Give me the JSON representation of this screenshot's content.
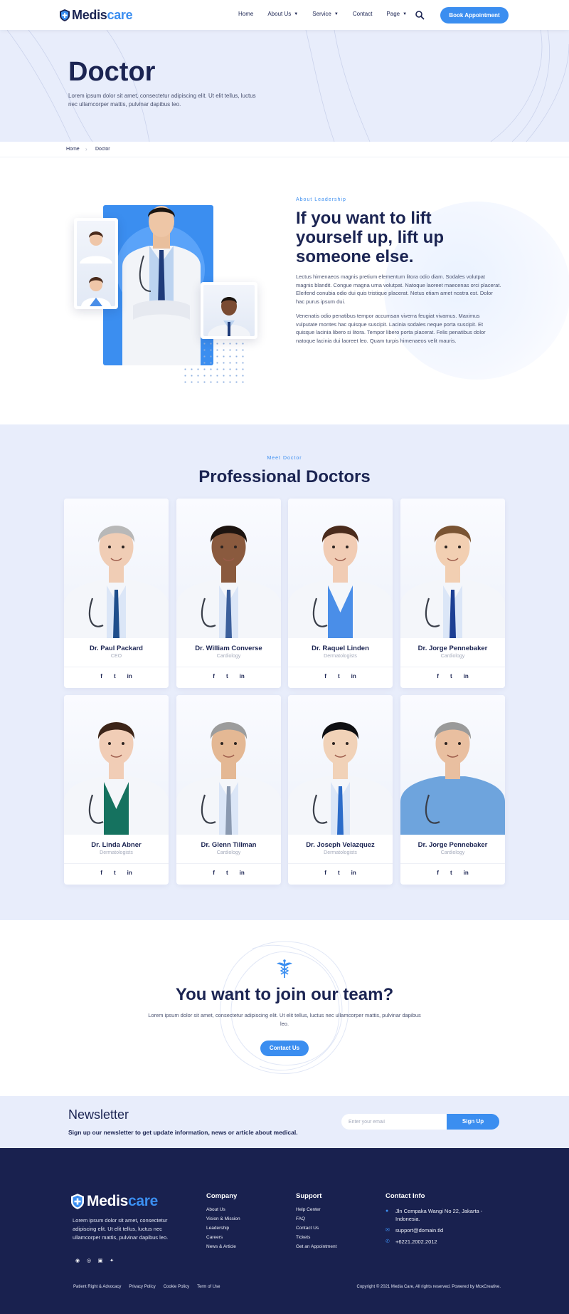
{
  "header": {
    "logo_part1": "Medis",
    "logo_part2": "care",
    "nav": [
      {
        "label": "Home",
        "chevron": false
      },
      {
        "label": "About Us",
        "chevron": true
      },
      {
        "label": "Service",
        "chevron": true
      },
      {
        "label": "Contact",
        "chevron": false
      },
      {
        "label": "Page",
        "chevron": true
      }
    ],
    "book_label": "Book Appointment"
  },
  "hero": {
    "title": "Doctor",
    "text": "Lorem ipsum dolor sit amet, consectetur adipiscing elit. Ut elit tellus, luctus nec ullamcorper mattis, pulvinar dapibus leo."
  },
  "breadcrumb": {
    "home": "Home",
    "current": "Doctor"
  },
  "leadership": {
    "eyebrow": "About Leadership",
    "title": "If you want to lift yourself up, lift up someone else.",
    "p1": "Lectus himenaeos magnis pretium elementum litora odio diam. Sodales volutpat magnis blandit. Congue magna urna volutpat. Natoque laoreet maecenas orci placerat. Eleifend conubia odio dui quis tristique placerat. Netus etiam amet nostra est. Dolor hac purus ipsum dui.",
    "p2": "Venenatis odio penatibus tempor accumsan viverra feugiat vivamus. Maximus vulputate montes hac quisque suscipit. Lacinia sodales neque porta suscipit. Et quisque lacinia libero si litora. Tempor libero porta placerat. Felis penatibus dolor natoque lacinia dui laoreet leo. Quam turpis himenaeos velit mauris."
  },
  "doctors": {
    "eyebrow": "Meet Doctor",
    "title": "Professional Doctors",
    "social": [
      "f",
      "t",
      "in"
    ],
    "list": [
      {
        "name": "Dr. Paul Packard",
        "role": "CEO",
        "hair": "#b8b8b8",
        "skin": "#f0cdb5",
        "scrub": "#ffffff",
        "tie": "#1e4e8c"
      },
      {
        "name": "Dr. William Converse",
        "role": "Cardiology",
        "hair": "#1d1410",
        "skin": "#8a5a3e",
        "scrub": "#ffffff",
        "tie": "#3b5f9c"
      },
      {
        "name": "Dr. Raquel Linden",
        "role": "Dermatologists",
        "hair": "#4a2b1c",
        "skin": "#f1ccb4",
        "scrub": "#4a8ee8",
        "tie": ""
      },
      {
        "name": "Dr. Jorge Pennebaker",
        "role": "Cardiology",
        "hair": "#7a5433",
        "skin": "#f2cfb2",
        "scrub": "#ffffff",
        "tie": "#1c3f94"
      },
      {
        "name": "Dr. Linda Abner",
        "role": "Dermatologists",
        "hair": "#3c2418",
        "skin": "#f1cdb6",
        "scrub": "#15725f",
        "tie": ""
      },
      {
        "name": "Dr. Glenn Tillman",
        "role": "Cardiology",
        "hair": "#9c9c9c",
        "skin": "#e4b894",
        "scrub": "#ffffff",
        "tie": "#8a99b0"
      },
      {
        "name": "Dr. Joseph Velazquez",
        "role": "Dermatologists",
        "hair": "#0f0f12",
        "skin": "#f1d2b8",
        "scrub": "#ffffff",
        "tie": "#2c6cc9"
      },
      {
        "name": "Dr. Jorge Pennebaker",
        "role": "Cardiology",
        "hair": "#9a9a9a",
        "skin": "#e9bfa0",
        "scrub": "#6ea4dd",
        "tie": ""
      }
    ]
  },
  "join": {
    "title": "You want to join our team?",
    "text": "Lorem ipsum dolor sit amet, consectetur adipiscing elit. Ut elit tellus, luctus nec ullamcorper mattis, pulvinar dapibus leo.",
    "button": "Contact Us"
  },
  "newsletter": {
    "title": "Newsletter",
    "text": "Sign up our newsletter to get update information, news or article about medical.",
    "placeholder": "Enter your email",
    "button": "Sign Up"
  },
  "footer": {
    "logo_part1": "Medis",
    "logo_part2": "care",
    "about": "Lorem ipsum dolor sit amet, consectetur adipiscing elit. Ut elit tellus, luctus nec ullamcorper mattis, pulvinar dapibus leo.",
    "company_title": "Company",
    "company_links": [
      "About Us",
      "Vision & Mission",
      "Leadership",
      "Careers",
      "News & Article"
    ],
    "support_title": "Support",
    "support_links": [
      "Help Center",
      "FAQ",
      "Contact Us",
      "Tickets",
      "Get an Appointment"
    ],
    "contact_title": "Contact Info",
    "address": "Jln Cempaka Wangi No 22, Jakarta - Indonesia.",
    "email": "support@domain.tld",
    "phone": "+6221.2002.2012",
    "bottom_links": [
      "Patient Right & Advocacy",
      "Privacy Policy",
      "Cookie Policy",
      "Term of Use"
    ],
    "copyright": "Copyright © 2021 Media Care, All rights reserved. Powered by MoxCreative."
  },
  "colors": {
    "accent": "#3b8ef0",
    "navy": "#1b2452",
    "light_bg": "#e8edfb",
    "footer_bg": "#19214f"
  }
}
